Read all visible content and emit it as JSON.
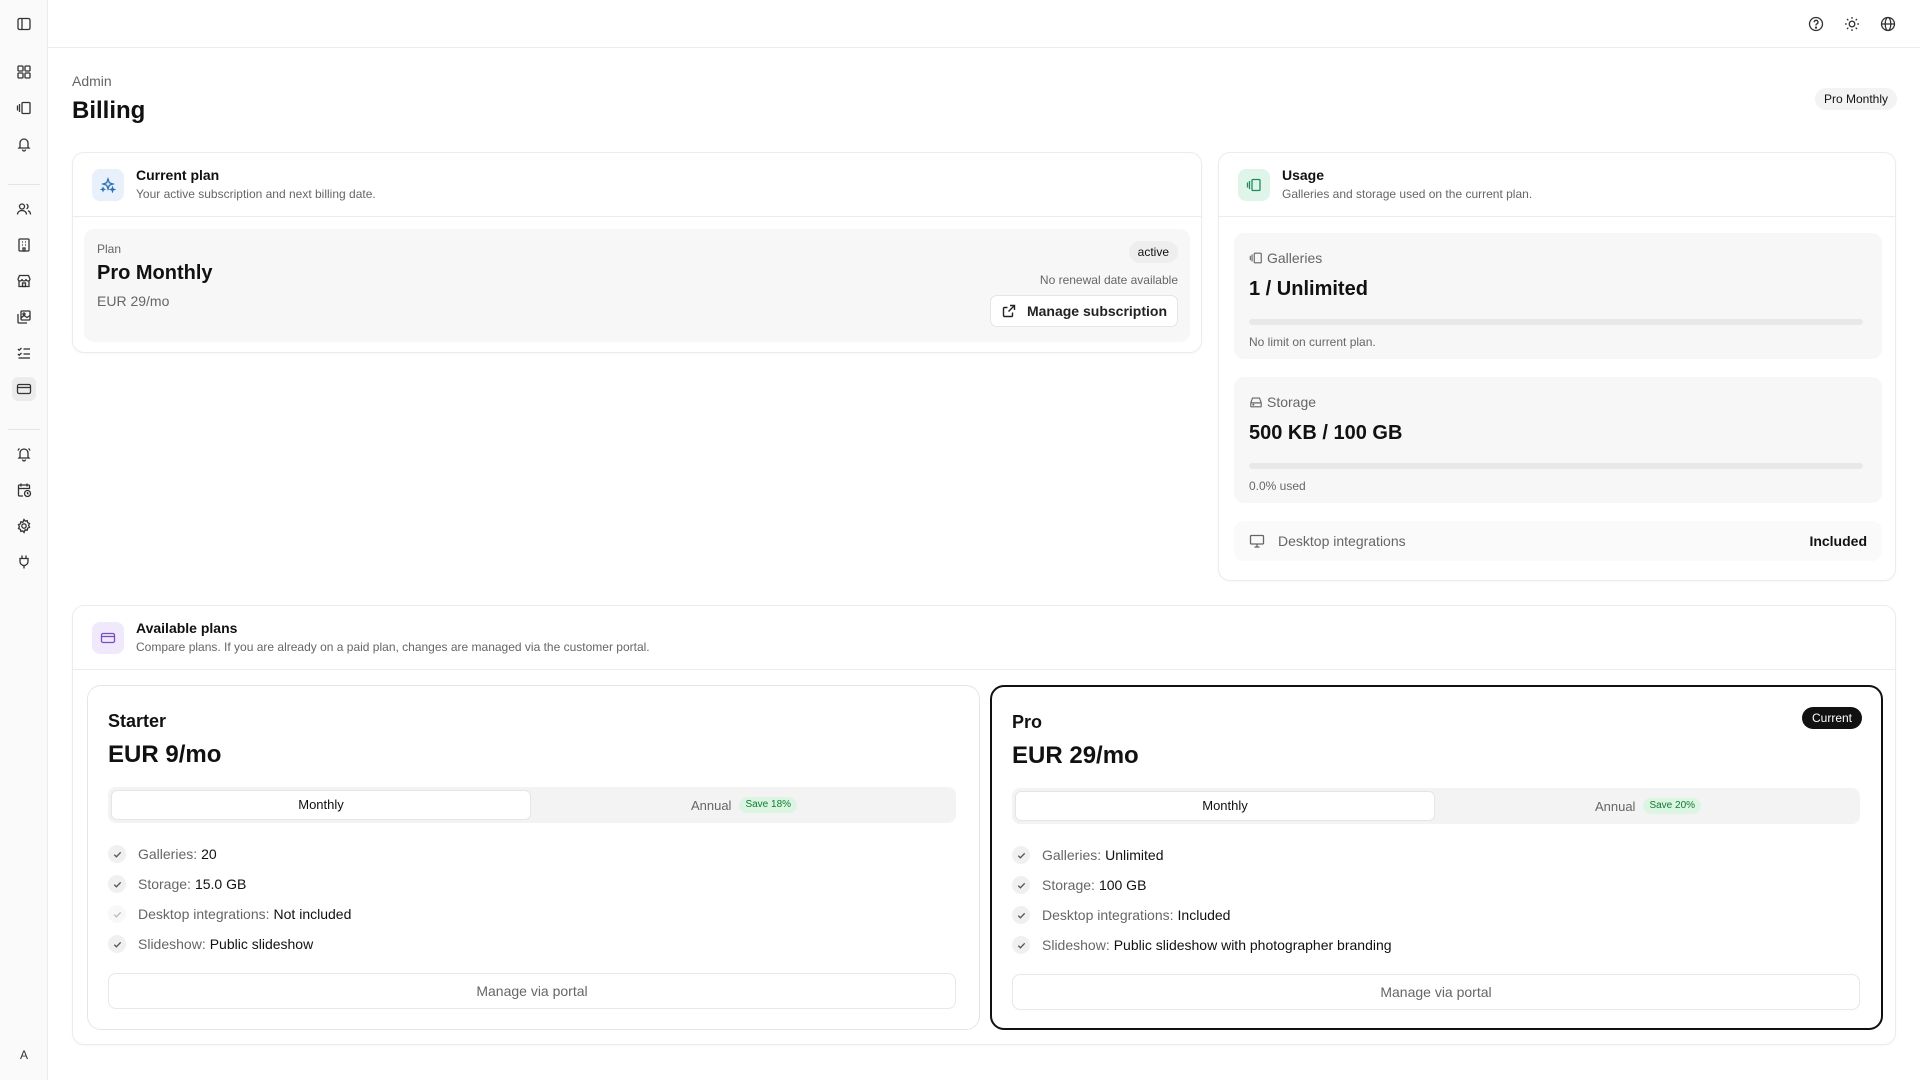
{
  "sidebar": {
    "avatar_initial": "A"
  },
  "page": {
    "breadcrumb": "Admin",
    "title": "Billing",
    "plan_badge": "Pro Monthly"
  },
  "current_plan": {
    "title": "Current plan",
    "subtitle": "Your active subscription and next billing date.",
    "plan_label": "Plan",
    "plan_name": "Pro Monthly",
    "price": "EUR 29/mo",
    "status": "active",
    "renewal": "No renewal date available",
    "manage_button": "Manage subscription"
  },
  "usage": {
    "title": "Usage",
    "subtitle": "Galleries and storage used on the current plan.",
    "galleries": {
      "label": "Galleries",
      "value": "1 / Unlimited",
      "note": "No limit on current plan.",
      "fill": 0
    },
    "storage": {
      "label": "Storage",
      "value": "500 KB / 100 GB",
      "note": "0.0% used",
      "fill": 0
    },
    "desktop": {
      "label": "Desktop integrations",
      "value": "Included"
    }
  },
  "available_plans": {
    "title": "Available plans",
    "subtitle": "Compare plans. If you are already on a paid plan, changes are managed via the customer portal.",
    "plans": [
      {
        "name": "Starter",
        "price": "EUR 9/mo",
        "toggle_monthly": "Monthly",
        "toggle_annual": "Annual",
        "save": "Save 18%",
        "features": [
          {
            "key": "Galleries:",
            "value": "20"
          },
          {
            "key": "Storage:",
            "value": "15.0 GB"
          },
          {
            "key": "Desktop integrations:",
            "value": "Not included"
          },
          {
            "key": "Slideshow:",
            "value": "Public slideshow"
          }
        ],
        "button": "Manage via portal"
      },
      {
        "name": "Pro",
        "price": "EUR 29/mo",
        "current_badge": "Current",
        "toggle_monthly": "Monthly",
        "toggle_annual": "Annual",
        "save": "Save 20%",
        "features": [
          {
            "key": "Galleries:",
            "value": "Unlimited"
          },
          {
            "key": "Storage:",
            "value": "100 GB"
          },
          {
            "key": "Desktop integrations:",
            "value": "Included"
          },
          {
            "key": "Slideshow:",
            "value": "Public slideshow with photographer branding"
          }
        ],
        "button": "Manage via portal"
      }
    ]
  },
  "colors": {
    "current_plan_icon_bg": "#e8f1fb",
    "current_plan_icon": "#2f6fb3",
    "usage_icon_bg": "#dff5ea",
    "usage_icon": "#1f8a5a",
    "plans_icon_bg": "#f0e9fb",
    "plans_icon": "#7a4bc2",
    "save_badge_bg": "#dcf5e3",
    "save_badge_text": "#0f7a2e"
  }
}
